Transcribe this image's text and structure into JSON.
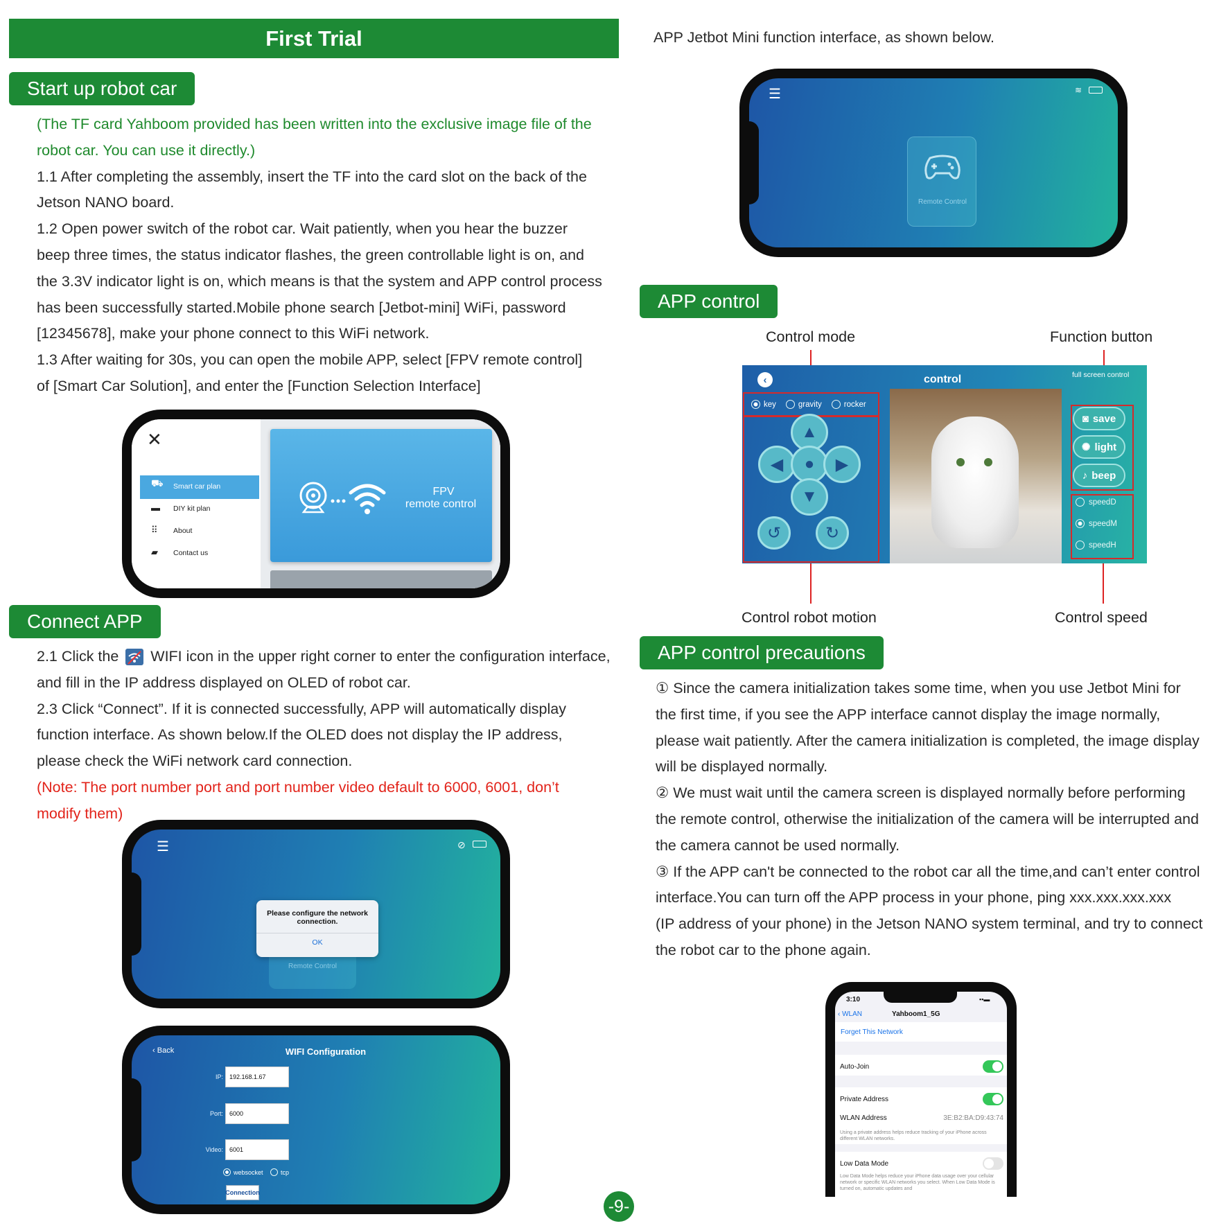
{
  "page_title": "First Trial",
  "sections": {
    "startup": {
      "tag": "Start up robot car",
      "note_lines": [
        "(The TF card Yahboom provided has been written into the exclusive image file of the",
        "robot car. You can use it directly.)"
      ],
      "lines": [
        "1.1 After completing the assembly, insert the TF into the card slot on the back of the",
        "Jetson NANO board.",
        "1.2 Open power switch of the robot car. Wait patiently, when you hear the buzzer",
        "beep three times, the status indicator flashes, the green controllable light is on, and",
        "the 3.3V indicator light is on, which means is that the system and APP control process",
        "has been successfully started.Mobile phone search [Jetbot-mini] WiFi, password",
        "[12345678], make your phone connect to this WiFi network.",
        "1.3 After waiting for 30s, you can open the mobile APP, select [FPV remote control]",
        "of [Smart Car Solution], and enter the [Function Selection Interface]"
      ]
    },
    "connect": {
      "tag": "Connect APP",
      "line1_pre": "2.1 Click the",
      "line1_post": "WIFI icon in the upper right corner to enter the configuration interface,",
      "lines": [
        "and fill in the IP address displayed on OLED of robot car.",
        "2.3 Click “Connect”. If it is connected successfully, APP will automatically display",
        "function interface. As shown below.If the OLED does not display the IP address,",
        "please check the WiFi network card connection."
      ],
      "note_lines": [
        "(Note: The port number port and port number video default to 6000, 6001, don’t",
        "modify them)"
      ]
    },
    "function_intro": "APP Jetbot Mini function interface, as shown below.",
    "app_control": {
      "tag": "APP control",
      "labels": {
        "control_mode": "Control mode",
        "function_button": "Function button",
        "control_robot_motion": "Control robot motion",
        "control_speed": "Control speed"
      }
    },
    "precautions": {
      "tag": "APP control precautions",
      "lines": [
        "① Since the camera initialization takes some time, when you use Jetbot Mini for",
        "the first time, if you see the APP interface cannot display the image normally,",
        "please wait patiently. After the camera initialization is completed, the image display",
        "will be displayed normally.",
        "② We must wait until the camera screen is displayed normally before performing",
        "the remote control, otherwise the initialization of the camera will be interrupted and",
        "the camera cannot be used normally.",
        "③ If the APP can't be connected to the robot car all the time,and can’t enter control",
        "interface.You can turn off the APP process in your phone, ping xxx.xxx.xxx.xxx",
        "(IP address of your phone) in the Jetson NANO system terminal, and try to connect",
        "the robot car to the phone again."
      ]
    }
  },
  "menu_screen": {
    "close": "✕",
    "items": [
      "Smart car plan",
      "DIY kit plan",
      "About",
      "Contact us"
    ],
    "card_title_1": "FPV",
    "card_title_2": "remote control"
  },
  "jetbot_screen": {
    "center_label": "Remote Control"
  },
  "dialog_screen": {
    "message_1": "Please configure the network",
    "message_2": "connection.",
    "ok": "OK",
    "center_label": "Remote Control"
  },
  "wifi_config_screen": {
    "back": "Back",
    "title": "WIFI Configuration",
    "ip_label": "IP:",
    "ip_value": "192.168.1.67",
    "port_label": "Port:",
    "port_value": "6000",
    "video_label": "Video:",
    "video_value": "6001",
    "opt_websocket": "websocket",
    "opt_tcp": "tcp",
    "connect_button": "Connection"
  },
  "control_screen": {
    "title": "control",
    "full_screen": "full screen control",
    "modes": [
      "key",
      "gravity",
      "rocker"
    ],
    "buttons": [
      "save",
      "light",
      "beep"
    ],
    "speeds": [
      "speedD",
      "speedM",
      "speedH"
    ]
  },
  "ios_wifi_screen": {
    "time": "3:10",
    "back": "WLAN",
    "network": "Yahboom1_5G",
    "forget": "Forget This Network",
    "auto_join": "Auto-Join",
    "private_address": "Private Address",
    "wlan_address": "WLAN Address",
    "wlan_address_value": "3E:B2:BA:D9:43:74",
    "private_note": "Using a private address helps reduce tracking of your iPhone across different WLAN networks.",
    "low_data_mode": "Low Data Mode",
    "low_data_note": "Low Data Mode helps reduce your iPhone data usage over your cellular network or specific WLAN networks you select. When Low Data Mode is turned on, automatic updates and"
  },
  "page_number": "-9-",
  "colors": {
    "brand_green": "#1d8a35",
    "note_green": "#1f8a2d",
    "note_red": "#e2231a",
    "annot_red": "#d62a2a"
  }
}
